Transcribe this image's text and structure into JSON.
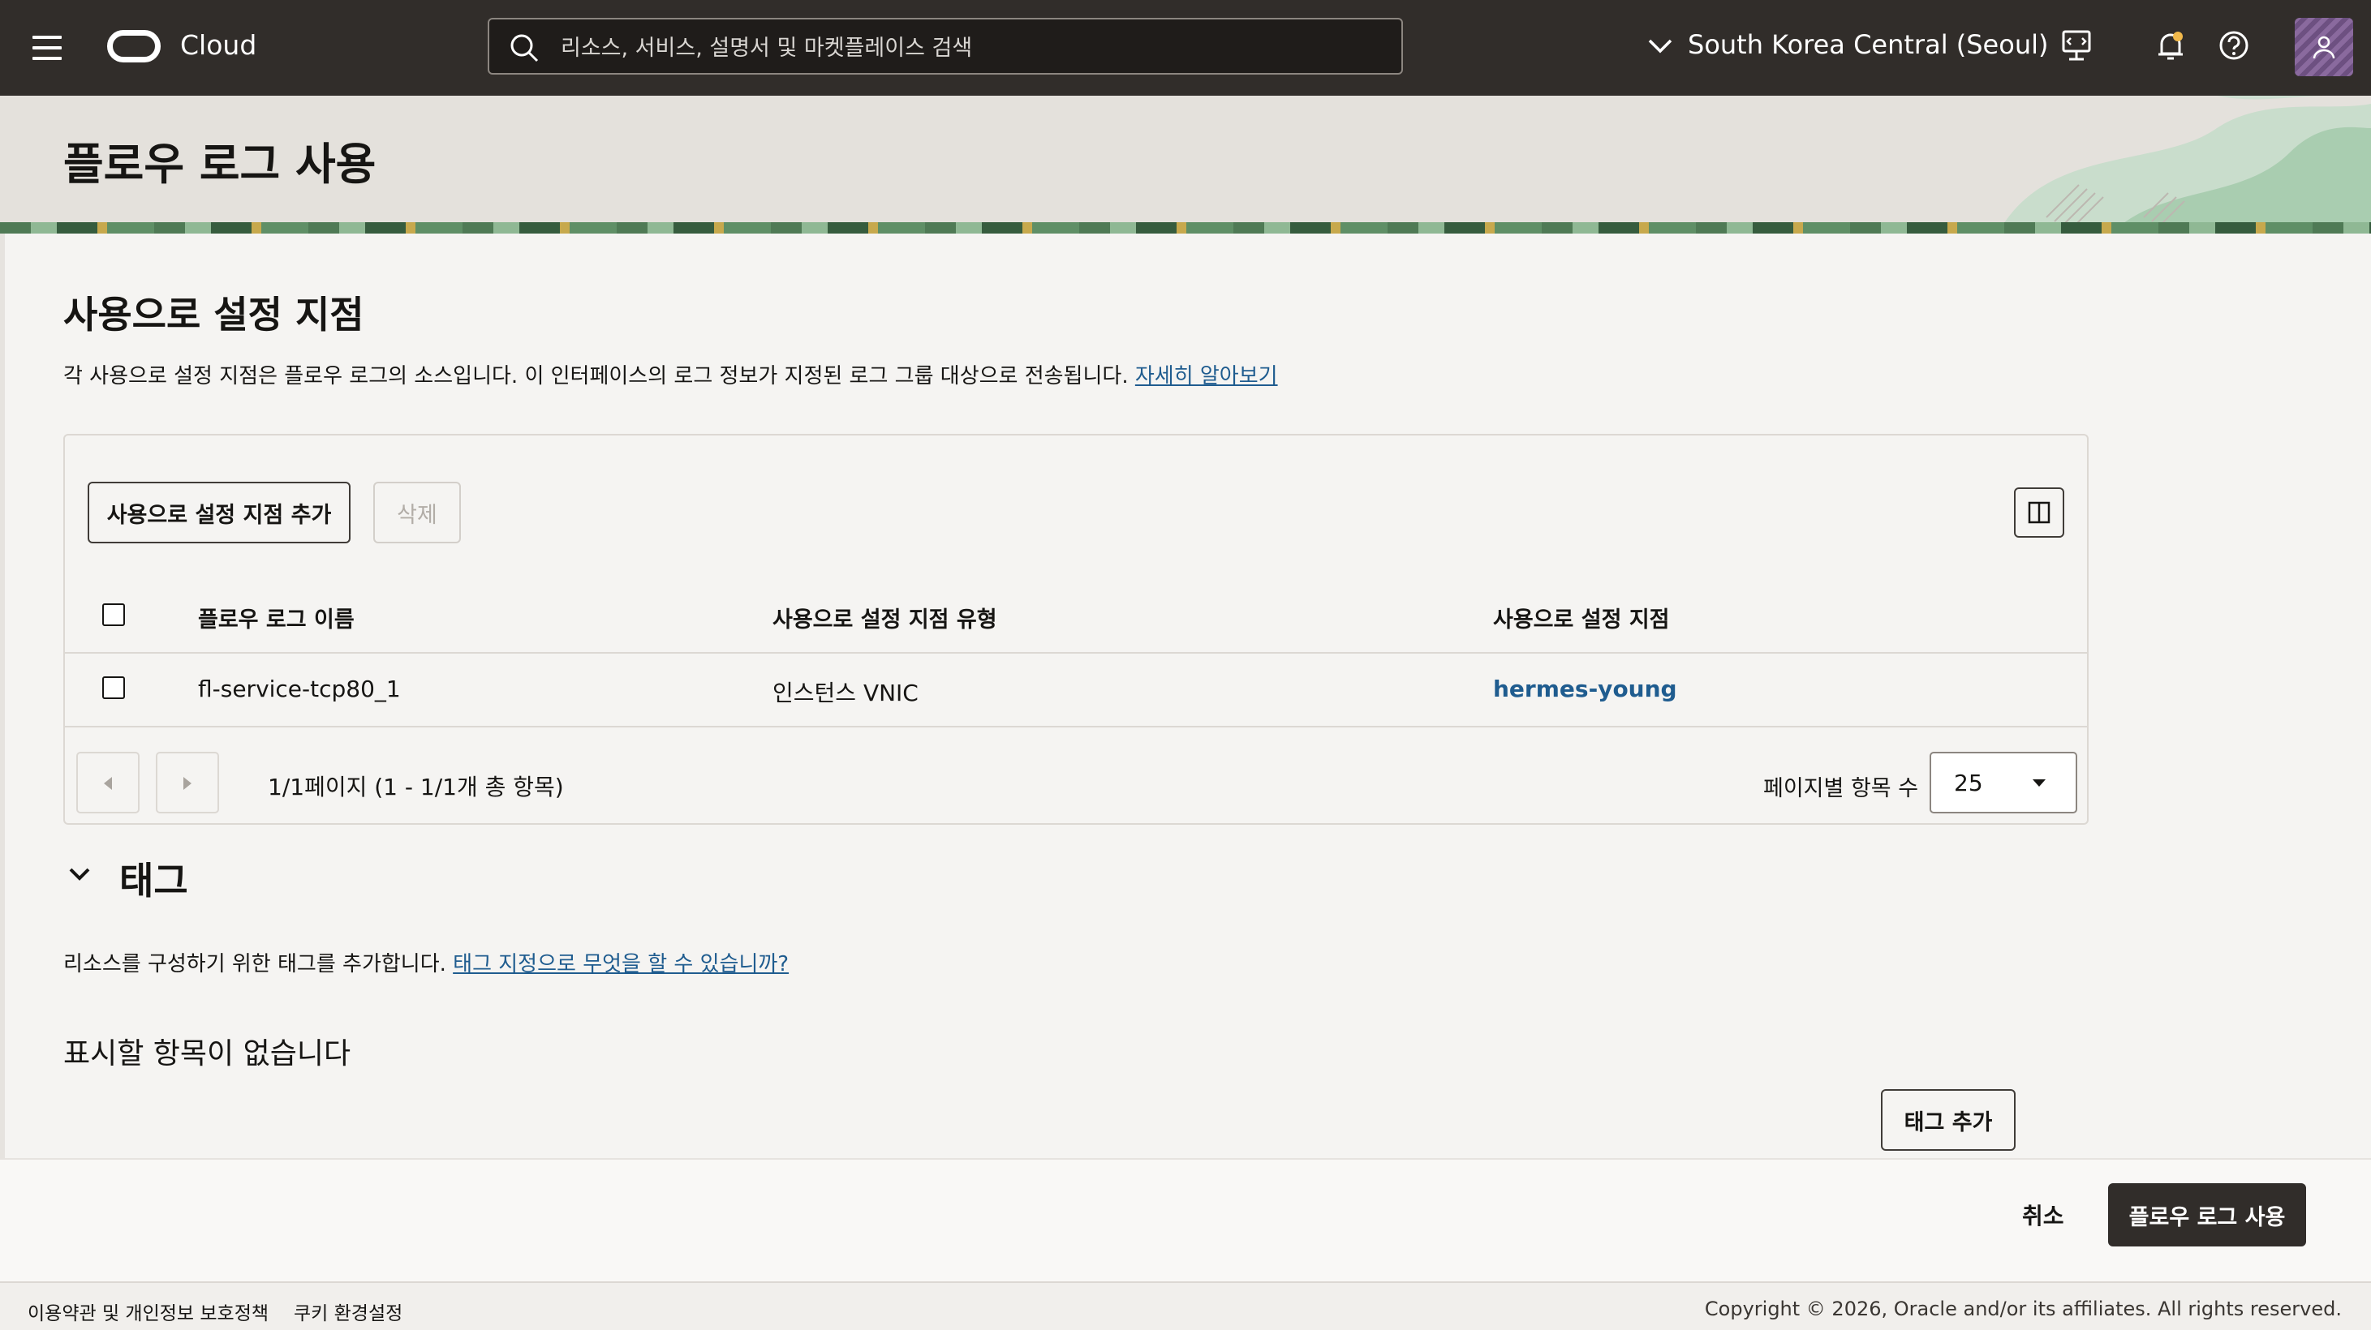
{
  "header": {
    "brand": "Cloud",
    "search_placeholder": "리소스, 서비스, 설명서 및 마켓플레이스 검색",
    "region": "South Korea Central (Seoul)"
  },
  "page": {
    "title": "플로우 로그 사용"
  },
  "enablement": {
    "title": "사용으로 설정 지점",
    "description": "각 사용으로 설정 지점은 플로우 로그의 소스입니다. 이 인터페이스의 로그 정보가 지정된 로그 그룹 대상으로 전송됩니다. ",
    "learn_more": "자세히 알아보기",
    "add_button": "사용으로 설정 지점 추가",
    "delete_button": "삭제",
    "columns": [
      "플로우 로그 이름",
      "사용으로 설정 지점 유형",
      "사용으로 설정 지점"
    ],
    "rows": [
      {
        "name": "fl-service-tcp80_1",
        "type": "인스턴스 VNIC",
        "point": "hermes-young"
      }
    ],
    "pagination": "1/1페이지 (1 - 1/1개 총 항목)",
    "per_page_label": "페이지별 항목 수",
    "per_page_value": "25"
  },
  "tags": {
    "title": "태그",
    "description": "리소스를 구성하기 위한 태그를 추가합니다. ",
    "link": "태그 지정으로 무엇을 할 수 있습니까?",
    "empty": "표시할 항목이 없습니다",
    "add_button": "태그 추가"
  },
  "actions": {
    "cancel": "취소",
    "submit": "플로우 로그 사용"
  },
  "footer": {
    "terms": "이용약관 및 개인정보 보호정책",
    "cookies": "쿠키 환경설정",
    "copyright": "Copyright © 2026, Oracle and/or its affiliates. All rights reserved."
  }
}
